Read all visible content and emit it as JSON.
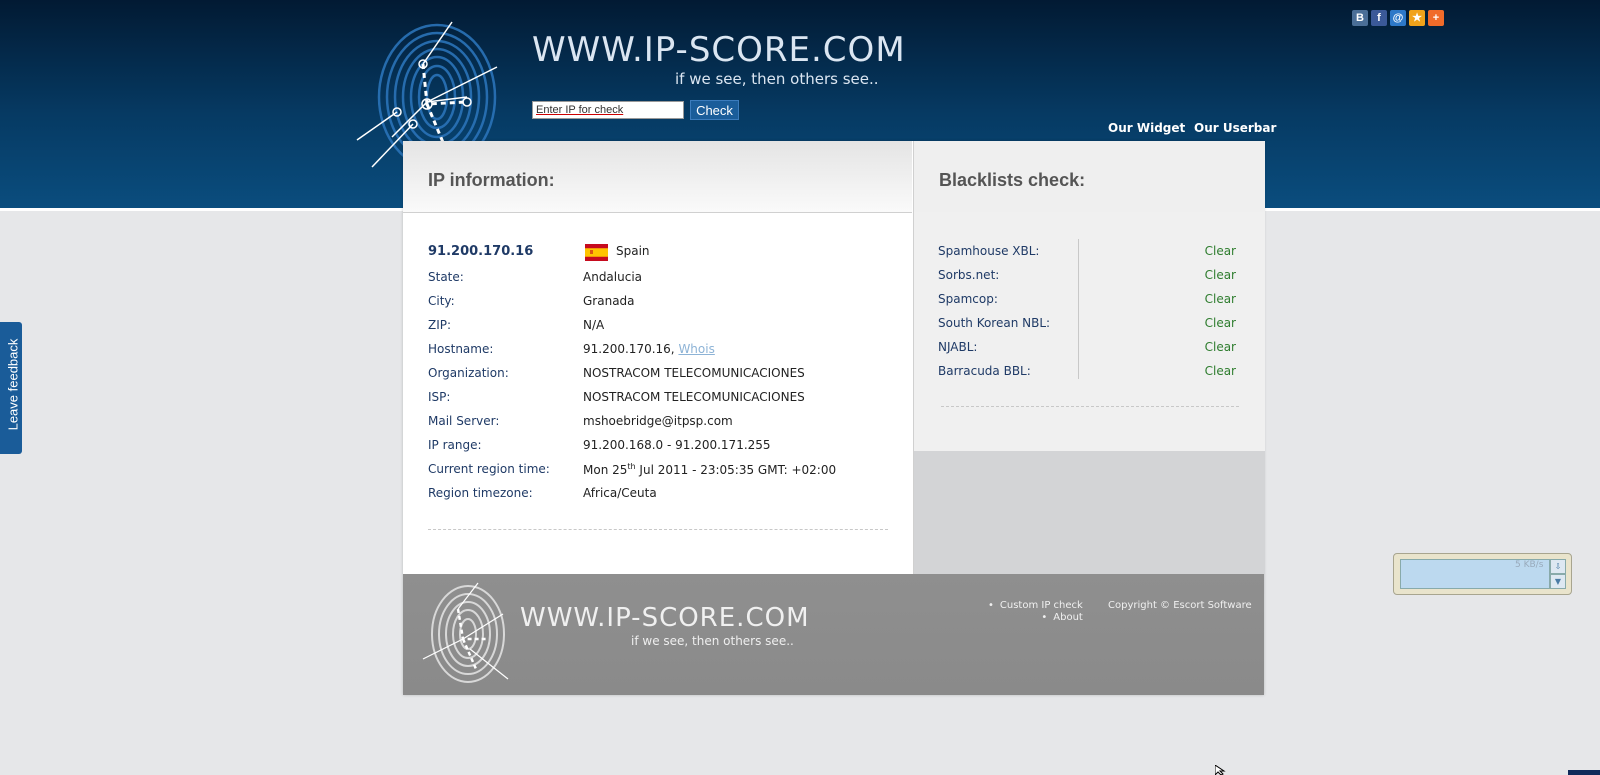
{
  "header": {
    "logo_text": "WWW.IP-SCORE.COM",
    "tagline": "if we see, then others see..",
    "search_placeholder": "Enter IP for check",
    "check_label": "Check",
    "links": [
      "Our Widget",
      "Our Userbar"
    ],
    "social_icons": [
      "vkontakte-icon",
      "facebook-icon",
      "myworld-icon",
      "bookmark-star-icon",
      "addthis-plus-icon"
    ]
  },
  "feedback_label": "Leave feedback",
  "ip_info": {
    "title": "IP information:",
    "ip": "91.200.170.16",
    "country": "Spain",
    "rows": [
      {
        "label": "State:",
        "value": "Andalucia"
      },
      {
        "label": "City:",
        "value": "Granada"
      },
      {
        "label": "ZIP:",
        "value": "N/A"
      },
      {
        "label": "Hostname:",
        "value": "91.200.170.16,",
        "link": "Whois"
      },
      {
        "label": "Organization:",
        "value": "NOSTRACOM TELECOMUNICACIONES"
      },
      {
        "label": "ISP:",
        "value": "NOSTRACOM TELECOMUNICACIONES"
      },
      {
        "label": "Mail Server:",
        "value": "mshoebridge@itpsp.com"
      },
      {
        "label": "IP range:",
        "value": "91.200.168.0 - 91.200.171.255"
      },
      {
        "label": "Current region time:",
        "value_pre": "Mon 25",
        "value_sup": "th",
        "value_post": " Jul 2011 - 23:05:35 GMT: +02:00"
      },
      {
        "label": "Region timezone:",
        "value": "Africa/Ceuta"
      }
    ]
  },
  "blacklists": {
    "title": "Blacklists check:",
    "items": [
      {
        "name": "Spamhouse XBL:",
        "status": "Clear"
      },
      {
        "name": "Sorbs.net:",
        "status": "Clear"
      },
      {
        "name": "Spamcop:",
        "status": "Clear"
      },
      {
        "name": "South Korean NBL:",
        "status": "Clear"
      },
      {
        "name": "NJABL:",
        "status": "Clear"
      },
      {
        "name": "Barracuda BBL:",
        "status": "Clear"
      }
    ]
  },
  "footer": {
    "logo_text": "WWW.IP-SCORE.COM",
    "tagline": "if we see, then others see..",
    "links": [
      "Custom IP check",
      "About"
    ],
    "copyright": "Copyright © Escort Software"
  },
  "widget": {
    "speed": "5 KB/s"
  },
  "colors": {
    "header_bg": "#063a63",
    "accent_blue": "#1a5d9a",
    "clear_green": "#2f7d2f",
    "label_blue": "#1f3a66"
  }
}
